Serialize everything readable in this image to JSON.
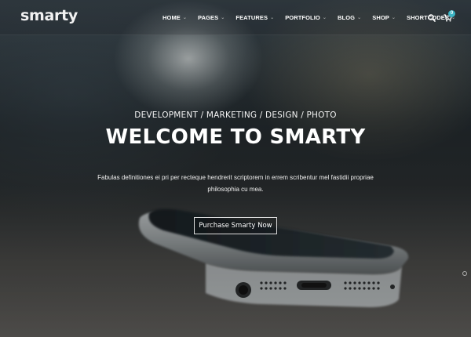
{
  "brand": {
    "logo": "smarty"
  },
  "nav": {
    "items": [
      {
        "label": "HOME"
      },
      {
        "label": "PAGES"
      },
      {
        "label": "FEATURES"
      },
      {
        "label": "PORTFOLIO"
      },
      {
        "label": "BLOG"
      },
      {
        "label": "SHOP"
      },
      {
        "label": "SHORTCODES"
      }
    ],
    "caret": "⌄",
    "search_icon": "search-icon",
    "cart_icon": "shopping-cart-icon",
    "cart_count": "0"
  },
  "hero": {
    "subtitle": "DEVELOPMENT / MARKETING / DESIGN / PHOTO",
    "title": "WELCOME TO SMARTY",
    "description": "Fabulas definitiones ei pri per recteque hendrerit scriptorem in errem scribentur mel fastidii propriae philosophia cu mea.",
    "cta_label": "Purchase Smarty Now"
  },
  "colors": {
    "accent": "#3cb5c5",
    "text": "#ffffff"
  }
}
